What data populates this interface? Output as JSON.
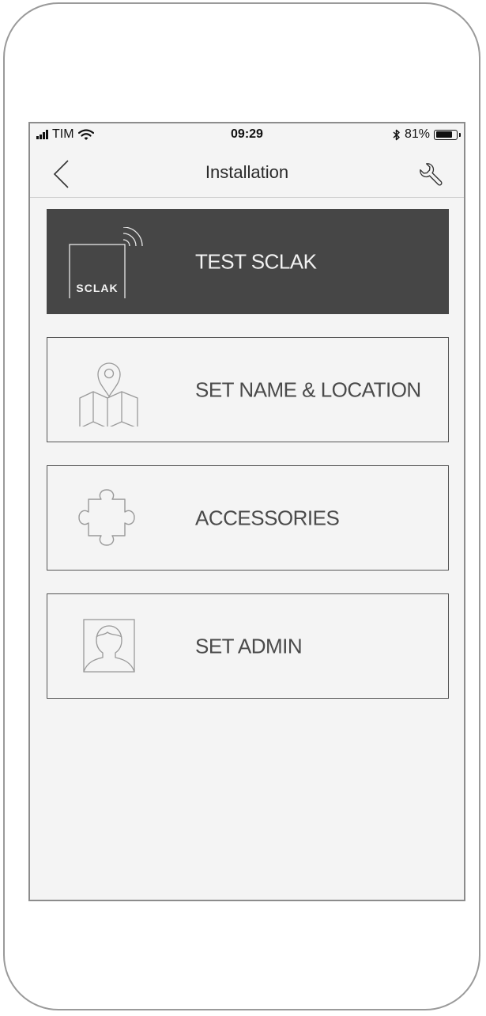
{
  "status_bar": {
    "carrier": "TIM",
    "time": "09:29",
    "battery_percent": "81%",
    "battery_level": 0.81,
    "icons": [
      "signal-icon",
      "wifi-icon",
      "bluetooth-icon",
      "battery-icon"
    ]
  },
  "nav": {
    "title": "Installation",
    "back_icon": "chevron-left-icon",
    "tool_icon": "wrench-icon"
  },
  "menu": {
    "items": [
      {
        "label": "TEST SCLAK",
        "icon": "sclak-device-icon",
        "icon_text": "SCLAK",
        "active": true
      },
      {
        "label": "SET NAME & LOCATION",
        "icon": "map-pin-icon",
        "active": false
      },
      {
        "label": "ACCESSORIES",
        "icon": "puzzle-piece-icon",
        "active": false
      },
      {
        "label": "SET ADMIN",
        "icon": "user-portrait-icon",
        "active": false
      }
    ]
  },
  "colors": {
    "active_bg": "#464646",
    "screen_bg": "#f4f4f4",
    "border": "#555555",
    "text": "#4a4a4a"
  }
}
